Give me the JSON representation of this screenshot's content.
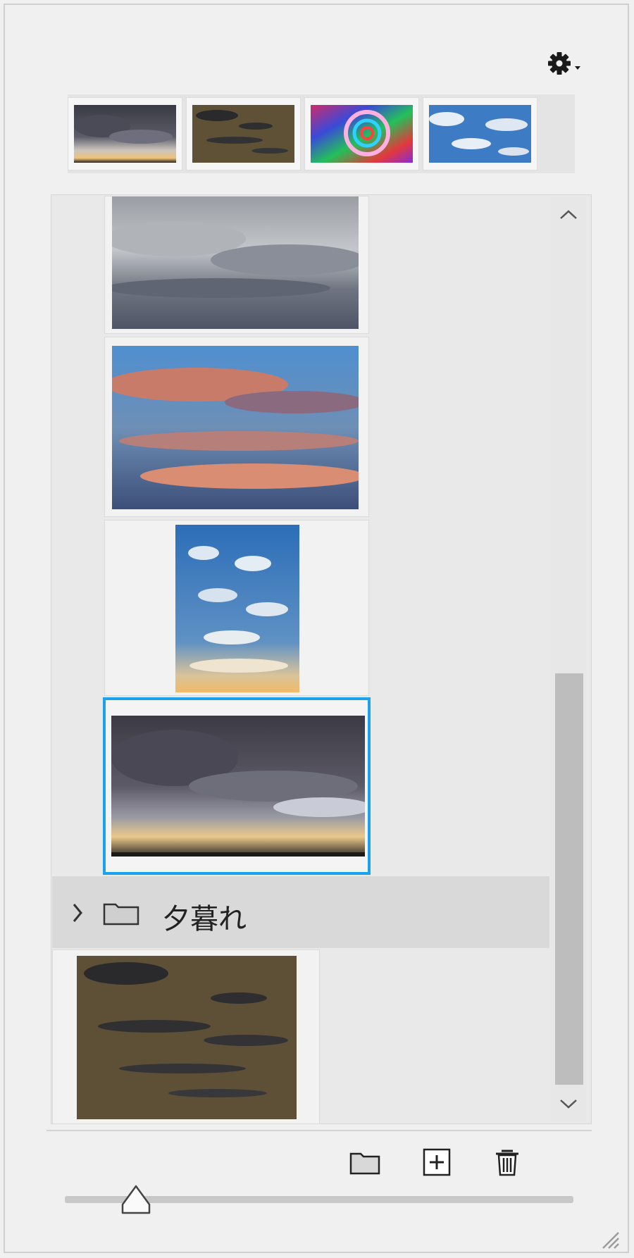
{
  "toolbar": {
    "settings_icon": "gear-icon",
    "settings_dropdown_icon": "caret-down-icon"
  },
  "recent_images": [
    {
      "name": "stormy-sunset-clouds"
    },
    {
      "name": "dark-dusk-clouds"
    },
    {
      "name": "colorful-swirl"
    },
    {
      "name": "blue-sky-clouds"
    }
  ],
  "library": {
    "items": [
      {
        "name": "gray-overcast-sky"
      },
      {
        "name": "pink-sunset-clouds"
      },
      {
        "name": "blue-sky-altocumulus"
      },
      {
        "name": "storm-over-horizon",
        "selected": true
      }
    ],
    "group": {
      "label": "夕暮れ",
      "expanded": false
    },
    "group_items": [
      {
        "name": "dark-dusk-clouds"
      }
    ]
  },
  "footer": {
    "new_folder_icon": "folder-icon",
    "add_icon": "add-square-icon",
    "delete_icon": "trash-icon",
    "thumbnail_size_fraction": 0.14
  },
  "colors": {
    "selection": "#1aa3ec",
    "panel_bg": "#f0f0f0",
    "group_row_bg": "#d9d9d9"
  }
}
